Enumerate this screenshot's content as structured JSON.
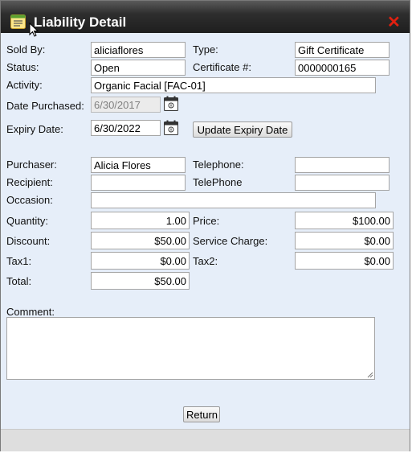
{
  "window": {
    "title": "Liability Detail",
    "close_label": "✕"
  },
  "labels": {
    "sold_by": "Sold By:",
    "type": "Type:",
    "status": "Status:",
    "certificate": "Certificate #:",
    "activity": "Activity:",
    "date_purchased": "Date Purchased:",
    "expiry_date": "Expiry Date:",
    "purchaser": "Purchaser:",
    "telephone": "Telephone:",
    "recipient": "Recipient:",
    "telephone2": "TelePhone",
    "occasion": "Occasion:",
    "quantity": "Quantity:",
    "price": "Price:",
    "discount": "Discount:",
    "service_charge": "Service Charge:",
    "tax1": "Tax1:",
    "tax2": "Tax2:",
    "total": "Total:",
    "comment": "Comment:"
  },
  "fields": {
    "sold_by": "aliciaflores",
    "type": "Gift Certificate",
    "status": "Open",
    "certificate": "0000000165",
    "activity": "Organic Facial [FAC-01]",
    "date_purchased": "6/30/2017",
    "expiry_date": "6/30/2022",
    "purchaser": "Alicia Flores",
    "telephone": "",
    "recipient": "",
    "telephone2": "",
    "occasion": "",
    "quantity": "1.00",
    "price": "$100.00",
    "discount": "$50.00",
    "service_charge": "$0.00",
    "tax1": "$0.00",
    "tax2": "$0.00",
    "total": "$50.00",
    "comment": ""
  },
  "buttons": {
    "update_expiry": "Update Expiry Date",
    "return": "Return"
  },
  "icons": {
    "title": "notepad-icon",
    "calendar": "calendar-icon",
    "close": "close-icon",
    "cursor": "mouse-pointer-icon"
  },
  "colors": {
    "close": "#e02010",
    "body_bg": "#e6eef9",
    "title_bg": "#2e2e2e"
  }
}
